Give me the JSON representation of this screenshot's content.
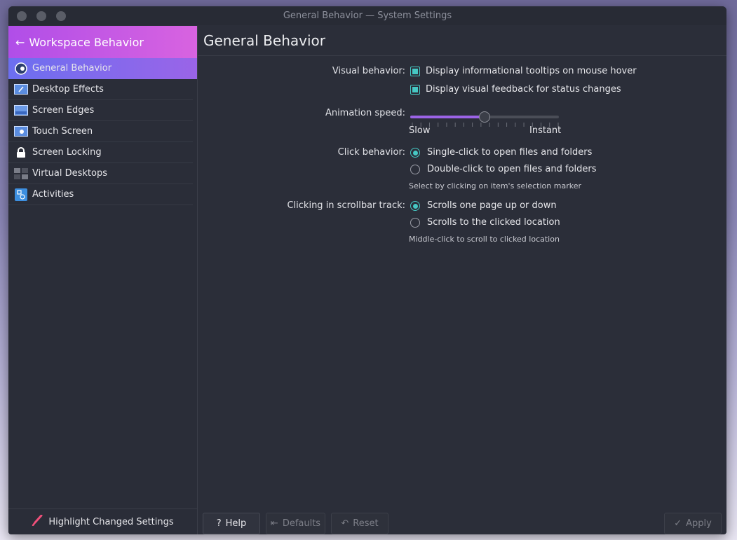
{
  "window": {
    "title": "General Behavior — System Settings"
  },
  "sidebar": {
    "header": "Workspace Behavior",
    "items": [
      {
        "label": "General Behavior",
        "icon": "general-behavior-icon",
        "active": true
      },
      {
        "label": "Desktop Effects",
        "icon": "desktop-effects-icon"
      },
      {
        "label": "Screen Edges",
        "icon": "screen-edges-icon"
      },
      {
        "label": "Touch Screen",
        "icon": "touch-screen-icon"
      },
      {
        "label": "Screen Locking",
        "icon": "lock-icon"
      },
      {
        "label": "Virtual Desktops",
        "icon": "virtual-desktops-icon"
      },
      {
        "label": "Activities",
        "icon": "activities-icon"
      }
    ],
    "footer": "Highlight Changed Settings"
  },
  "main": {
    "title": "General Behavior",
    "visual_behavior": {
      "label": "Visual behavior:",
      "options": [
        {
          "label": "Display informational tooltips on mouse hover",
          "checked": true
        },
        {
          "label": "Display visual feedback for status changes",
          "checked": true
        }
      ]
    },
    "animation_speed": {
      "label": "Animation speed:",
      "min_label": "Slow",
      "max_label": "Instant",
      "value": 0.5
    },
    "click_behavior": {
      "label": "Click behavior:",
      "options": [
        {
          "label": "Single-click to open files and folders",
          "selected": true
        },
        {
          "label": "Double-click to open files and folders",
          "selected": false
        }
      ],
      "hint": "Select by clicking on item's selection marker"
    },
    "scrollbar_track": {
      "label": "Clicking in scrollbar track:",
      "options": [
        {
          "label": "Scrolls one page up or down",
          "selected": true
        },
        {
          "label": "Scrolls to the clicked location",
          "selected": false
        }
      ],
      "hint": "Middle-click to scroll to clicked location"
    }
  },
  "buttons": {
    "help": "Help",
    "defaults": "Defaults",
    "reset": "Reset",
    "apply": "Apply"
  },
  "colors": {
    "accent": "#9b63e6",
    "check": "#46c8c4",
    "header": "#c45ae0"
  }
}
